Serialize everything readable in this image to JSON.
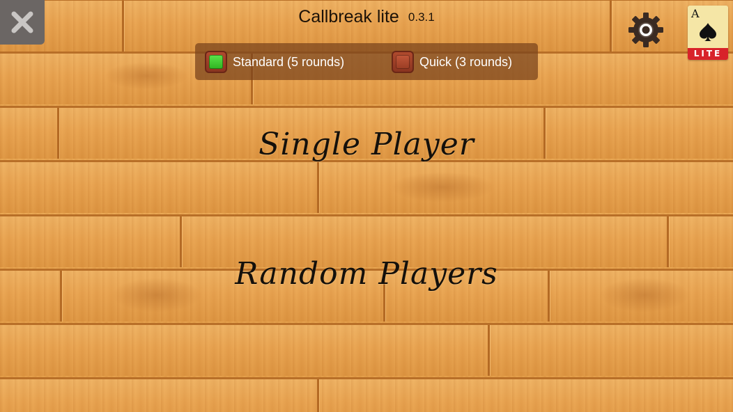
{
  "header": {
    "title": "Callbreak lite",
    "version": "0.3.1"
  },
  "logo": {
    "rank": "A",
    "badge": "LITE"
  },
  "mode_selector": {
    "options": [
      {
        "label": "Standard (5 rounds)",
        "selected": true
      },
      {
        "label": "Quick (3 rounds)",
        "selected": false
      }
    ]
  },
  "menu": {
    "single_player": "Single Player",
    "random_players": "Random Players"
  },
  "colors": {
    "wood": "#e8a24f",
    "panel": "#784221",
    "selected_checkbox": "#3fcf2e",
    "badge": "#d8222a"
  },
  "icons": {
    "close": "close-icon",
    "settings": "gear-icon",
    "spade": "spade-icon"
  }
}
